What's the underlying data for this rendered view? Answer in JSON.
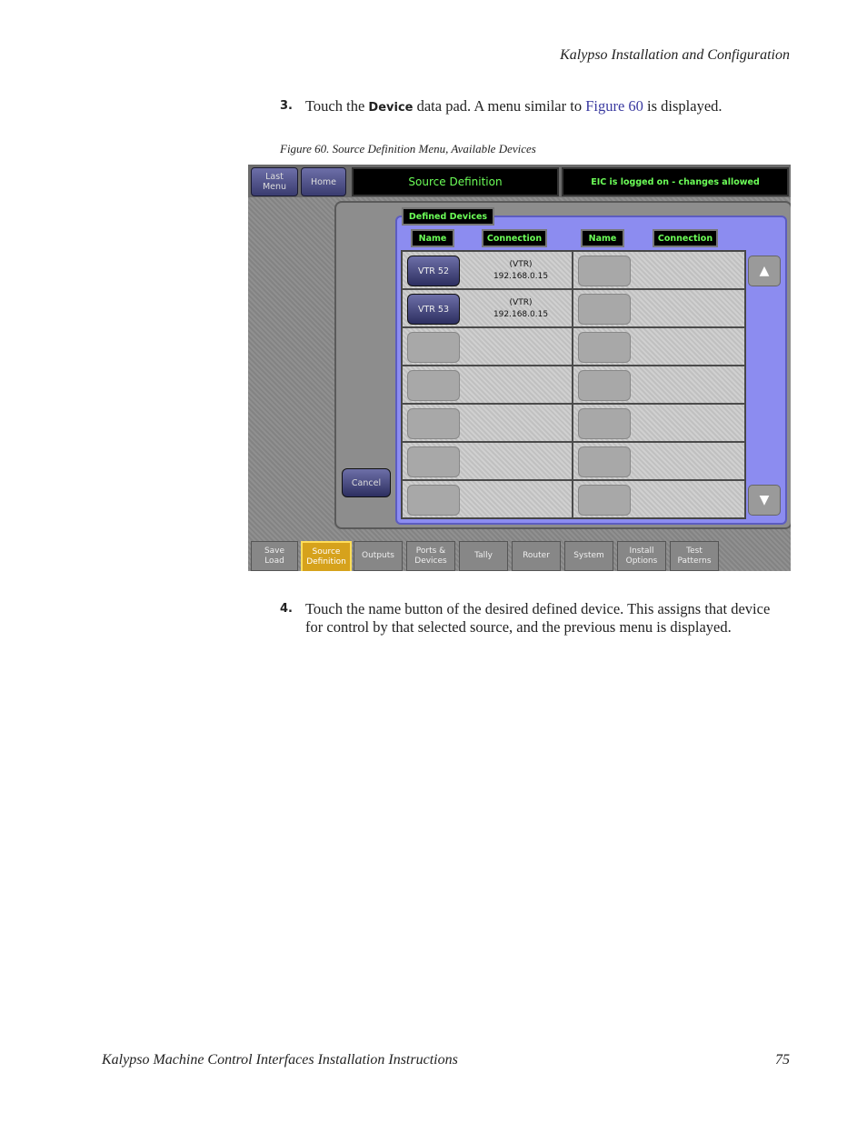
{
  "header": {
    "running_title": "Kalypso Installation and Configuration"
  },
  "step3": {
    "number": "3.",
    "text_before": "Touch the ",
    "keyword": "Device",
    "text_middle": " data pad. A menu similar to ",
    "link": "Figure 60",
    "text_after": " is displayed."
  },
  "figure": {
    "caption": "Figure 60.  Source Definition Menu, Available Devices"
  },
  "ui": {
    "last_menu": "Last\nMenu",
    "home": "Home",
    "title": "Source Definition",
    "status": "EIC is logged on - changes allowed",
    "defined_devices": "Defined Devices",
    "col_name_1": "Name",
    "col_connection_1": "Connection",
    "col_name_2": "Name",
    "col_connection_2": "Connection",
    "devices": [
      {
        "name": "VTR 52",
        "connection_type": "(VTR)",
        "address": "192.168.0.15"
      },
      {
        "name": "VTR 53",
        "connection_type": "(VTR)",
        "address": "192.168.0.15"
      }
    ],
    "cancel": "Cancel",
    "scroll_up": "▲",
    "scroll_down": "▼",
    "tabs": [
      {
        "label": "Save\nLoad"
      },
      {
        "label": "Source\nDefinition",
        "active": true
      },
      {
        "label": "Outputs"
      },
      {
        "label": "Ports &\nDevices"
      },
      {
        "label": "Tally"
      },
      {
        "label": "Router"
      },
      {
        "label": "System"
      },
      {
        "label": "Install\nOptions"
      },
      {
        "label": "Test\nPatterns"
      }
    ]
  },
  "step4": {
    "number": "4.",
    "text": "Touch the name button of the desired defined device. This assigns that device for control by that selected source, and the previous menu is displayed."
  },
  "footer": {
    "doc_title": "Kalypso Machine Control Interfaces Installation Instructions",
    "page_number": "75"
  }
}
